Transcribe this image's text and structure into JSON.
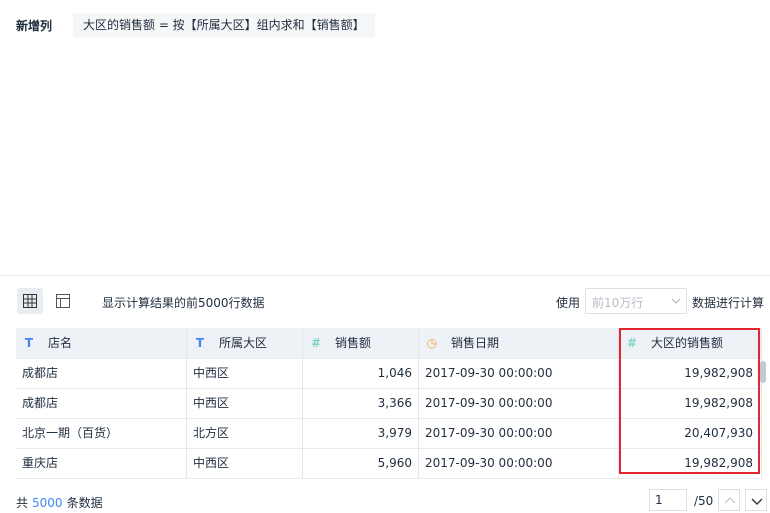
{
  "new_column": {
    "label": "新增列",
    "formula": "大区的销售额 = 按【所属大区】组内求和【销售额】"
  },
  "toolbar": {
    "grid_view_icon": "grid-icon",
    "field_view_icon": "layout-icon",
    "hint": "显示计算结果的前5000行数据",
    "use_label": "使用",
    "select_value": "前10万行",
    "after_label": "数据进行计算"
  },
  "table": {
    "columns": [
      {
        "label": "店名",
        "icon": "T"
      },
      {
        "label": "所属大区",
        "icon": "T"
      },
      {
        "label": "销售额",
        "icon": "#"
      },
      {
        "label": "销售日期",
        "icon": "◷"
      },
      {
        "label": "大区的销售额",
        "icon": "#"
      }
    ],
    "rows": [
      [
        "成都店",
        "中西区",
        "1,046",
        "2017-09-30 00:00:00",
        "19,982,908"
      ],
      [
        "成都店",
        "中西区",
        "3,366",
        "2017-09-30 00:00:00",
        "19,982,908"
      ],
      [
        "北京一期（百货）",
        "北方区",
        "3,979",
        "2017-09-30 00:00:00",
        "20,407,930"
      ],
      [
        "重庆店",
        "中西区",
        "5,960",
        "2017-09-30 00:00:00",
        "19,982,908"
      ]
    ],
    "highlight_color": "#e0282e"
  },
  "footer": {
    "prefix": "共",
    "total": "5000",
    "suffix": "条数据",
    "page": "1",
    "page_total": "/50"
  }
}
